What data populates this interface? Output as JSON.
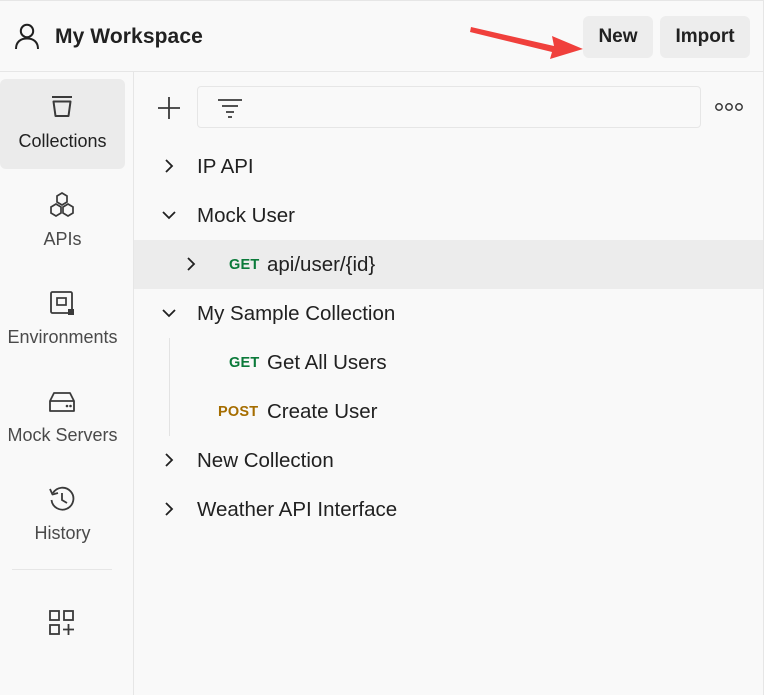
{
  "header": {
    "workspace_title": "My Workspace",
    "new_label": "New",
    "import_label": "Import",
    "annotation_arrow_color": "#f0403c"
  },
  "sidebar": {
    "items": [
      {
        "label": "Collections",
        "icon": "collections-icon",
        "active": true
      },
      {
        "label": "APIs",
        "icon": "apis-icon"
      },
      {
        "label": "Environments",
        "icon": "environments-icon"
      },
      {
        "label": "Mock Servers",
        "icon": "mock-servers-icon"
      },
      {
        "label": "History",
        "icon": "history-icon"
      }
    ],
    "more_icon": "configure-workbench-icon"
  },
  "toolbar": {
    "add_icon": "plus-icon",
    "search_placeholder": "",
    "filter_icon": "filter-icon",
    "more_icon": "more-options-icon"
  },
  "collections": [
    {
      "label": "IP API",
      "expanded": false
    },
    {
      "label": "Mock User",
      "expanded": true,
      "children": [
        {
          "method": "GET",
          "label": "api/user/{id}",
          "selected": true,
          "has_children": true
        }
      ]
    },
    {
      "label": "My Sample Collection",
      "expanded": true,
      "children": [
        {
          "method": "GET",
          "label": "Get All Users"
        },
        {
          "method": "POST",
          "label": "Create User"
        }
      ]
    },
    {
      "label": "New Collection",
      "expanded": false
    },
    {
      "label": "Weather API Interface",
      "expanded": false
    }
  ],
  "colors": {
    "get_method": "#0b7a3a",
    "post_method": "#a56d00",
    "selected_row": "#ececec",
    "background": "#f9f9f9"
  }
}
